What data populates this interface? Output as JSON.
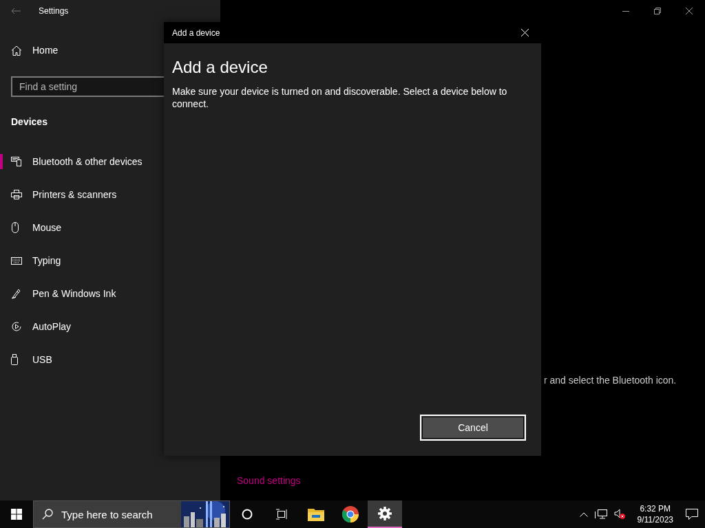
{
  "settings_window": {
    "title": "Settings",
    "home": "Home",
    "search": {
      "placeholder": "Find a setting"
    },
    "section": "Devices",
    "nav": [
      {
        "label": "Bluetooth & other devices",
        "kind": "devices",
        "selected": true
      },
      {
        "label": "Printers & scanners",
        "kind": "printer",
        "selected": false
      },
      {
        "label": "Mouse",
        "kind": "mouse",
        "selected": false
      },
      {
        "label": "Typing",
        "kind": "keyboard",
        "selected": false
      },
      {
        "label": "Pen & Windows Ink",
        "kind": "pen",
        "selected": false
      },
      {
        "label": "AutoPlay",
        "kind": "autoplay",
        "selected": false
      },
      {
        "label": "USB",
        "kind": "usb",
        "selected": false
      }
    ]
  },
  "background_page": {
    "instruction_fragment": "r and select the Bluetooth icon.",
    "links": [
      "Sound settings"
    ]
  },
  "dialog": {
    "title": "Add a device",
    "heading": "Add a device",
    "message": "Make sure your device is turned on and discoverable. Select a device below to connect.",
    "buttons": [
      {
        "label": "Cancel",
        "focused": true
      }
    ]
  },
  "taskbar": {
    "search": {
      "placeholder": "Type here to search"
    },
    "apps": [
      {
        "kind": "cortana",
        "active": false
      },
      {
        "kind": "taskview",
        "active": false
      },
      {
        "kind": "explorer",
        "active": false
      },
      {
        "kind": "chrome",
        "active": false
      },
      {
        "kind": "settings",
        "active": true
      }
    ],
    "clock": {
      "time": "6:32 PM",
      "date": "9/11/2023"
    }
  }
}
